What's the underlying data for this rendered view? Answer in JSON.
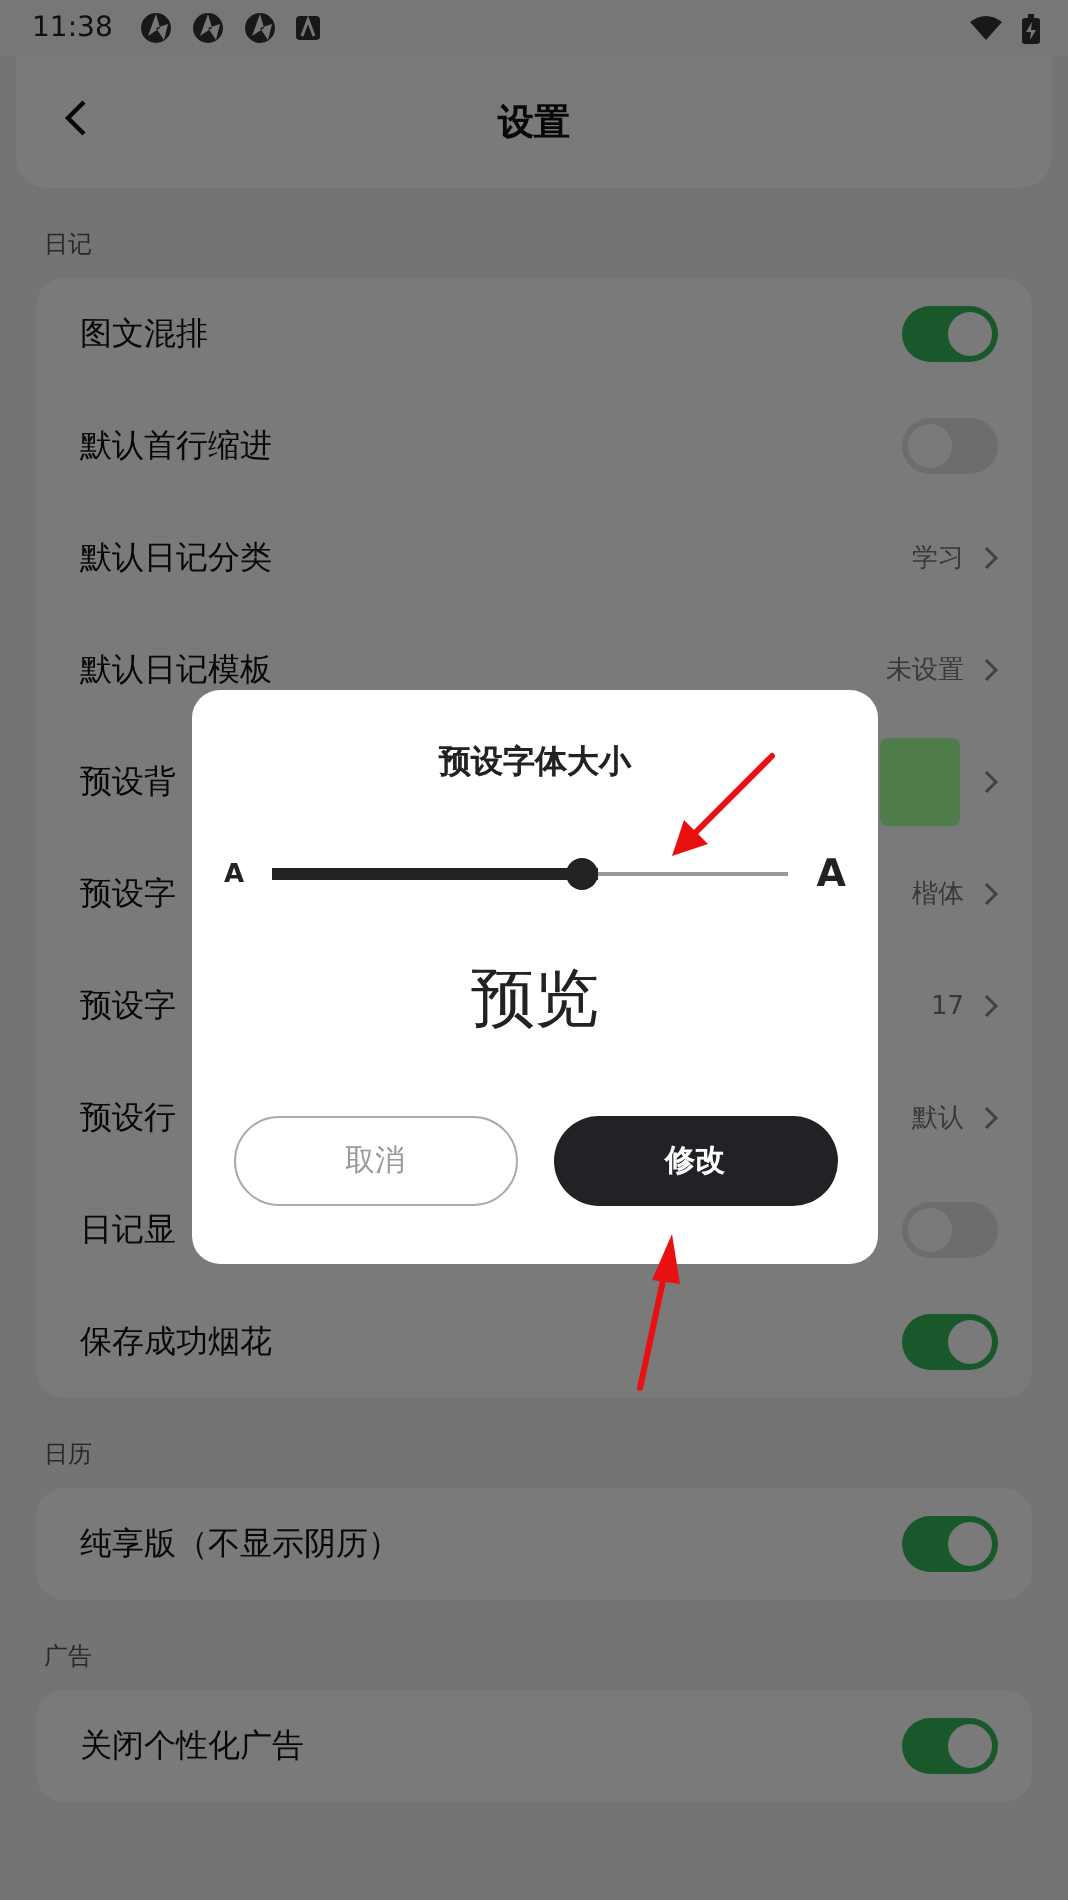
{
  "status_bar": {
    "time": "11:38"
  },
  "header": {
    "title": "设置"
  },
  "sections": [
    {
      "title": "日记",
      "rows": [
        {
          "label": "图文混排",
          "kind": "toggle",
          "on": true
        },
        {
          "label": "默认首行缩进",
          "kind": "toggle",
          "on": false
        },
        {
          "label": "默认日记分类",
          "kind": "value",
          "value": "学习"
        },
        {
          "label": "默认日记模板",
          "kind": "value",
          "value": "未设置"
        },
        {
          "label": "预设背",
          "kind": "swatch",
          "color": "#4e7d4b"
        },
        {
          "label": "预设字",
          "kind": "value",
          "value": "楷体"
        },
        {
          "label": "预设字",
          "kind": "value",
          "value": "17"
        },
        {
          "label": "预设行",
          "kind": "value",
          "value": "默认"
        },
        {
          "label": "日记显",
          "kind": "toggle",
          "on": false
        },
        {
          "label": "保存成功烟花",
          "kind": "toggle",
          "on": true
        }
      ]
    },
    {
      "title": "日历",
      "rows": [
        {
          "label": "纯享版（不显示阴历）",
          "kind": "toggle",
          "on": true
        }
      ]
    },
    {
      "title": "广告",
      "rows": [
        {
          "label": "关闭个性化广告",
          "kind": "toggle",
          "on": true
        }
      ]
    }
  ],
  "dialog": {
    "title": "预设字体大小",
    "small_label": "A",
    "large_label": "A",
    "level": 0.6,
    "preview": "预览",
    "buttons": [
      {
        "label": "取消",
        "kind": "secondary"
      },
      {
        "label": "修改",
        "kind": "primary"
      }
    ]
  }
}
